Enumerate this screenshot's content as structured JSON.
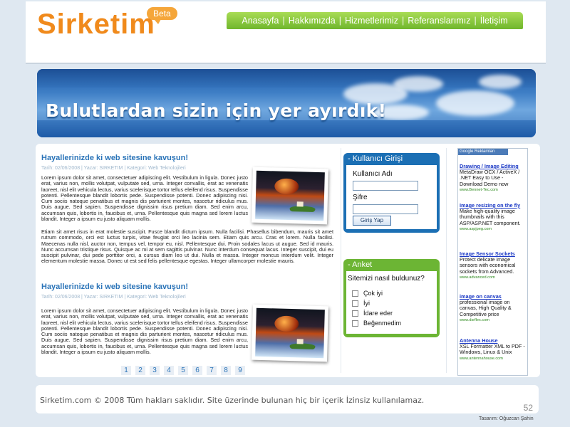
{
  "header": {
    "logo_text": "Sirketim",
    "beta_badge": "Beta",
    "nav": [
      "Anasayfa",
      "Hakkımızda",
      "Hizmetlerimiz",
      "Referanslarımız",
      "İletişim"
    ],
    "nav_separator": "|"
  },
  "banner": {
    "slogan": "Bulutlardan sizin için yer ayırdık!"
  },
  "articles": [
    {
      "title": "Hayallerinizde ki web sitesine kavuşun!",
      "meta": "Tarih: 02/06/2008 | Yazar: SIRKETIM | Kategori: Web Teknolojileri",
      "text_wrap": "Lorem ipsum dolor sit amet, consectetuer adipiscing elit. Vestibulum in ligula. Donec justo erat, varius non, mollis volutpat, vulputate sed, urna. Integer convallis, erat ac venenatis laoreet, nisl elit vehicula lectus, varius scelerisque tortor tellus eleifend risus. Suspendisse potenti. Pellentesque blandit lobortis pede. Suspendisse potenti. Donec adipiscing nisi. Cum sociis natoque penatibus et magnis dis parturient montes, nascetur ridiculus mus. Duis augue. Sed sapien. Suspendisse dignissim risus pretium diam. Sed enim arcu, accumsan quis, lobortis in, faucibus et, urna. Pellentesque quis magna sed lorem luctus blandit. Integer a ipsum eu justo aliquam mollis.",
      "text_full": "Etiam sit amet risus in erat molestie suscipit. Fusce blandit dictum ipsum. Nulla facilisi. Phasellus bibendum, mauris sit amet rutrum commodo, orci est luctus turpis, vitae feugiat orci leo lacinia sem. Etiam quis arcu. Cras et lorem. Nulla facilisi. Maecenas nulla nisl, auctor non, tempus vel, tempor eu, nisl. Pellentesque dui. Proin sodales lacus ut augue. Sed id mauris. Nunc accumsan tristique risus. Quisque ac mi at sem sagittis pulvinar. Nunc interdum consequat lacus. Integer suscipit, dui eu suscipit pulvinar, dui pede porttitor orci, a cursus diam leo ut dui. Nulla et massa. Integer moncus interdum velit. Integer elementum molestie massa. Donec ut est sed felis pellentesque egestas. Integer ullamcorper molestie mauris."
    },
    {
      "title": "Hayallerinizde ki web sitesine kavuşun!",
      "meta": "Tarih: 02/06/2008 | Yazar: SIRKETIM | Kategori: Web Teknolojileri",
      "text_wrap": "Lorem ipsum dolor sit amet, consectetuer adipiscing elit. Vestibulum in ligula. Donec justo erat, varius non, mollis volutpat, vulputate sed, urna. Integer convallis, erat ac venenatis laoreet, nisl elit vehicula lectus, varius scelerisque tortor tellus eleifend risus. Suspendisse potenti. Pellentesque blandit lobortis pede. Suspendisse potenti. Donec adipiscing nisi. Cum sociis natoque penatibus et magnis dis parturient montes, nascetur ridiculus mus. Duis augue. Sed sapien. Suspendisse dignissim risus pretium diam. Sed enim arcu, accumsan quis, lobortis in, faucibus et, urna. Pellentesque quis magna sed lorem luctus blandit. Integer a ipsum eu justo aliquam mollis.",
      "text_full": ""
    }
  ],
  "pagination": [
    "1",
    "2",
    "3",
    "4",
    "5",
    "6",
    "7",
    "8",
    "9"
  ],
  "login": {
    "title": "- Kullanıcı Girişi",
    "username_label": "Kullanıcı Adı",
    "password_label": "Şifre",
    "submit_label": "Giriş Yap",
    "username_value": "",
    "password_value": ""
  },
  "poll": {
    "title": "- Anket",
    "question": "Sitemizi nasıl buldunuz?",
    "options": [
      "Çok iyi",
      "İyi",
      "İdare eder",
      "Beğenmedim"
    ]
  },
  "ads": {
    "header": "Google Reklamları",
    "items": [
      {
        "title": "Drawing / Image Editing",
        "desc": "MetaDraw OCX / ActiveX / .NET Easy to Use - Download Demo now",
        "url": "www.Bennet-Tec.com"
      },
      {
        "title": "Image resizing on the fly",
        "desc": "Make high-quality image thumbnails with this ASP/ASP.NET component.",
        "url": "www.aspjpeg.com"
      },
      {
        "title": "Image Sensor Sockets",
        "desc": "Protect delicate image sensors with economical sockets from Advanced.",
        "url": "www.advanced.com"
      },
      {
        "title": "image on canvas",
        "desc": "professional image on canvas, High Quality & Competitive price",
        "url": "www.dsrflex.com"
      },
      {
        "title": "Antenna House",
        "desc": "XSL Formatter XML to PDF - Windows, Linux & Unix",
        "url": "www.antennahouse.com"
      }
    ]
  },
  "footer": {
    "copyright": "Sirketim.com © 2008 Tüm hakları saklıdır. Site üzerinde bulunan hiç bir içerik İzinsiz kullanılamaz.",
    "count": "52",
    "design_credit": "Tasarım: Oğuzcan Şahin"
  },
  "colors": {
    "logo_orange": "#f08a1c",
    "nav_green": "#6fb62c",
    "login_blue": "#1b6fb4",
    "poll_green": "#6cb534",
    "link_blue": "#2b74b8",
    "background": "#dfe8f1"
  }
}
